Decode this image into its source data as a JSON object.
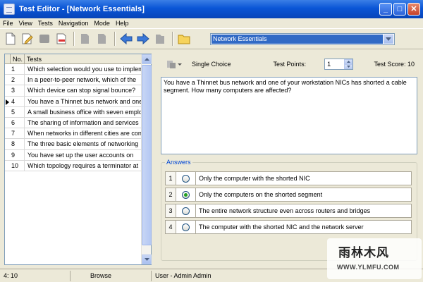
{
  "window": {
    "title": "Test Editor - [Network Essentials]"
  },
  "menu": [
    "File",
    "View",
    "Tests",
    "Navigation",
    "Mode",
    "Help"
  ],
  "toolbar": {
    "combo_value": "Network Essentials",
    "icons": [
      "new-icon",
      "edit-icon",
      "stop-icon",
      "delete-icon",
      "copy-icon",
      "paste-icon",
      "back-arrow-icon",
      "forward-arrow-icon",
      "book-icon",
      "folder-icon"
    ]
  },
  "tests": {
    "headers": {
      "no": "No.",
      "tests": "Tests"
    },
    "rows": [
      {
        "no": "1",
        "text": "Which selection would you use to implement"
      },
      {
        "no": "2",
        "text": "In a peer-to-peer network, which of the"
      },
      {
        "no": "3",
        "text": "Which device can stop signal bounce?"
      },
      {
        "no": "4",
        "text": "You have a Thinnet bus network and one"
      },
      {
        "no": "5",
        "text": "A small business office with seven employees"
      },
      {
        "no": "6",
        "text": "The sharing of information and services"
      },
      {
        "no": "7",
        "text": "When networks in different cities are connected"
      },
      {
        "no": "8",
        "text": "The three basic elements of networking"
      },
      {
        "no": "9",
        "text": "You have set up the user accounts on"
      },
      {
        "no": "10",
        "text": "Which topology requires a terminator at"
      }
    ],
    "current_row": 4
  },
  "question": {
    "type": "Single Choice",
    "points_label": "Test Points:",
    "points_value": "1",
    "score": "Test Score: 10",
    "text": "You have a Thinnet bus network and one of your workstation NICs has shorted a cable segment. How many computers are affected?"
  },
  "answers": {
    "legend": "Answers",
    "items": [
      {
        "no": "1",
        "text": "Only the computer with the shorted NIC",
        "selected": false
      },
      {
        "no": "2",
        "text": "Only the computers on the shorted segment",
        "selected": true
      },
      {
        "no": "3",
        "text": "The entire network structure even across routers and bridges",
        "selected": false
      },
      {
        "no": "4",
        "text": "The computer with the shorted NIC and the network server",
        "selected": false
      }
    ]
  },
  "status": {
    "position": "4: 10",
    "mode": "Browse",
    "user": "User - Admin Admin"
  },
  "watermark": {
    "logo": "雨林木风",
    "url": "WWW.YLMFU.COM"
  },
  "colors": {
    "titlebar": "#0a55d6",
    "selection": "#316ac5",
    "radio_on": "#21a121"
  }
}
